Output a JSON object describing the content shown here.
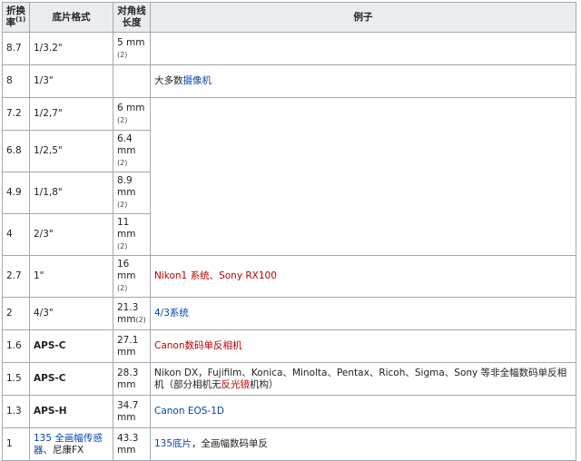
{
  "header": {
    "factor_label": "折换率",
    "factor_note": "(1)",
    "format_label": "底片格式",
    "diagonal_label": "对角线长度",
    "example_label": "例子"
  },
  "rows": [
    {
      "factor": "8.7",
      "format": "1/3.2\"",
      "diag": "5 mm",
      "note": "(2)"
    },
    {
      "factor": "8",
      "format": "1/3\"",
      "diag": "",
      "note": "",
      "ex_plain": "大多数",
      "ex_link": "摄像机"
    },
    {
      "factor": "7.2",
      "format": "1/2,7\"",
      "diag": "6 mm",
      "note": "(2)"
    },
    {
      "factor": "6.8",
      "format": "1/2,5\"",
      "diag": "6.4 mm",
      "note": "(2)"
    },
    {
      "factor": "4.9",
      "format": "1/1,8\"",
      "diag": "8.9 mm",
      "note": "(2)"
    },
    {
      "factor": "4",
      "format": "2/3\"",
      "diag": "11 mm",
      "note": "(2)"
    },
    {
      "factor": "2.7",
      "format": "1\"",
      "diag": "16 mm",
      "note": "(2)",
      "ex_red": "Nikon1 系统、Sony RX100"
    },
    {
      "factor": "2",
      "format": "4/3\"",
      "diag": "21.3 mm",
      "note": "(2)",
      "ex_blue": "4/3系统"
    },
    {
      "factor": "1.6",
      "format": "APS-C",
      "diag": "27.1 mm",
      "note": "",
      "ex_red": "Canon数码单反相机"
    },
    {
      "factor": "1.5",
      "format": "APS-C",
      "diag": "28.3 mm",
      "note": "",
      "ex_text": "Nikon DX，Fujifilm、Konica、Minolta、Pentax、Ricoh、Sigma、Sony 等非全幅数码单反相机（部分相机无",
      "ex_red_inline": "反光镜",
      "ex_tail": "机构）"
    },
    {
      "factor": "1.3",
      "format": "APS-H",
      "diag": "34.7 mm",
      "note": "",
      "ex_blue": "Canon EOS-1D"
    },
    {
      "factor": "1",
      "format_link": "135 全画幅传感器",
      "format_sub": "、尼康FX",
      "diag": "43.3 mm",
      "note": "",
      "ex_blue": "135底片",
      "ex_after": "，全画幅数码单反"
    }
  ],
  "colors": {
    "link": "#0645ad",
    "redlink": "#ba0000",
    "header_bg": "#eaecf0",
    "border": "#a2a9b1"
  }
}
